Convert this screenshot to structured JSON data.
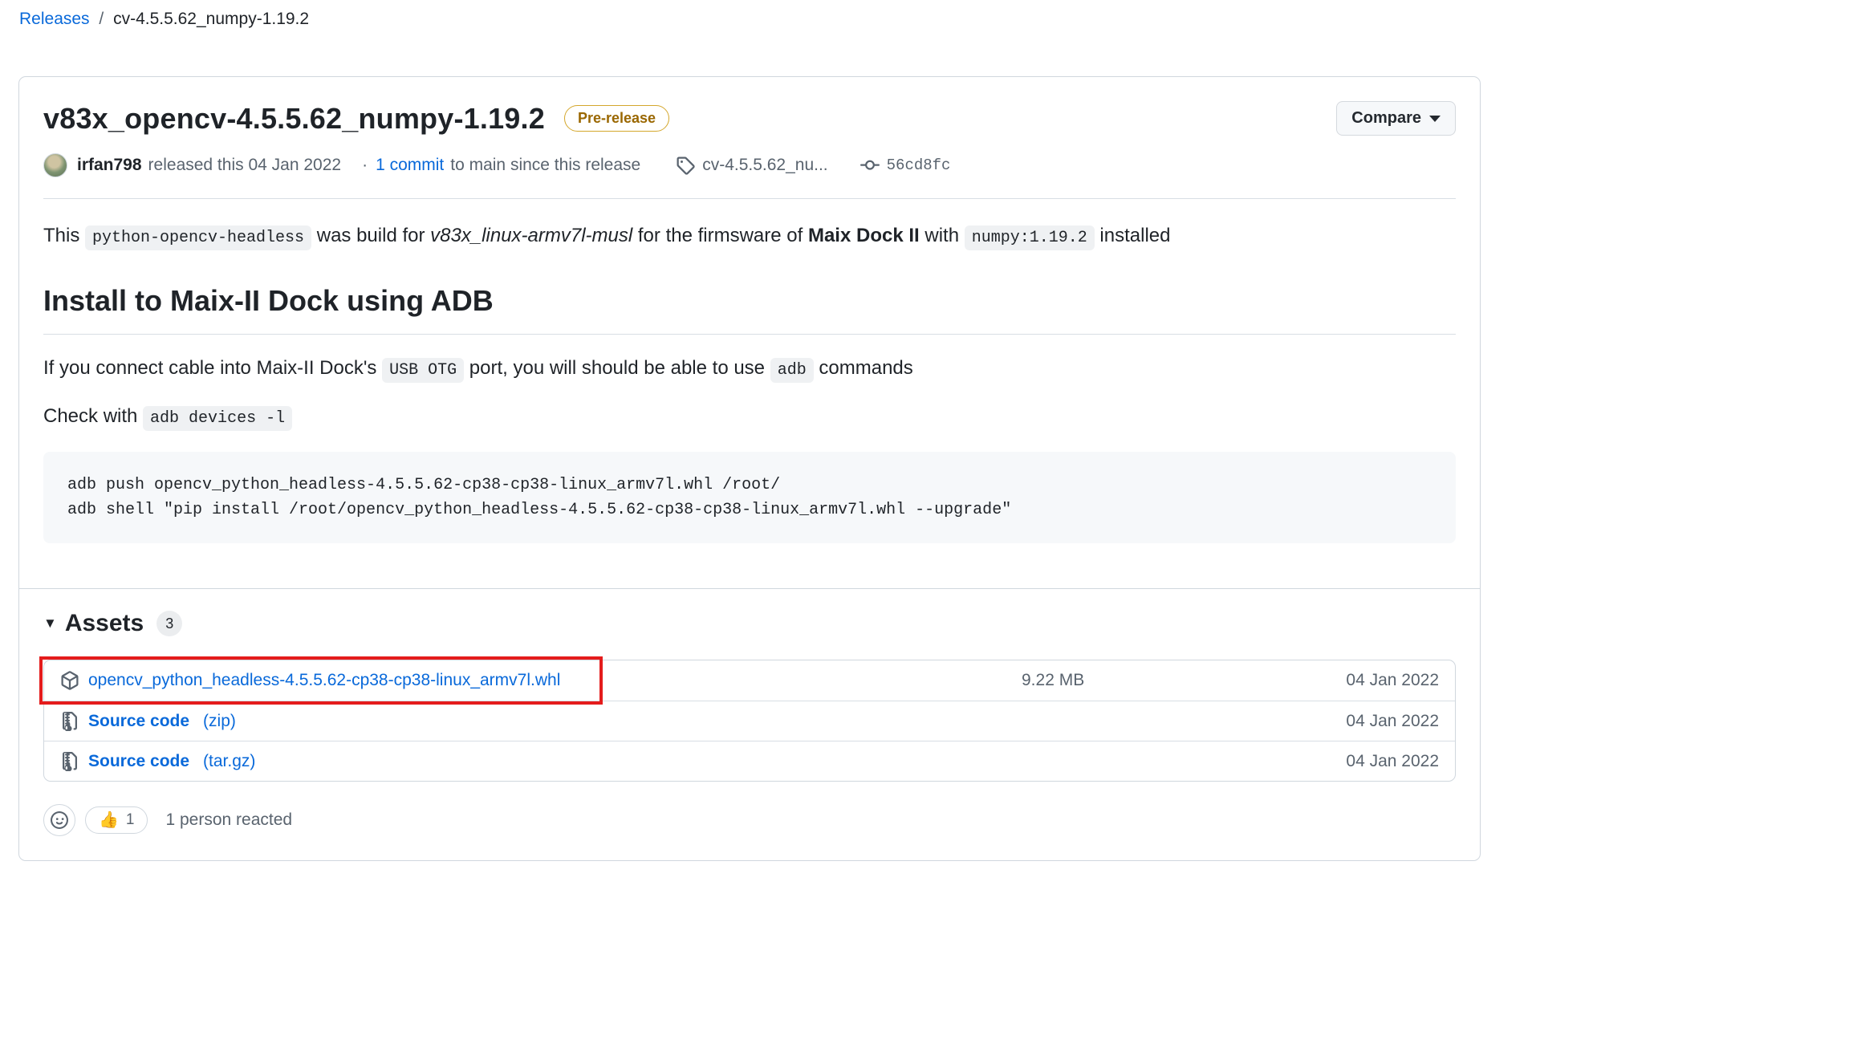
{
  "breadcrumb": {
    "releases": "Releases",
    "separator": "/",
    "current": "cv-4.5.5.62_numpy-1.19.2"
  },
  "header": {
    "title": "v83x_opencv-4.5.5.62_numpy-1.19.2",
    "prerelease_badge": "Pre-release",
    "compare_button": "Compare"
  },
  "meta": {
    "author": "irfan798",
    "released_text": "released this 04 Jan 2022",
    "dot": "·",
    "commit_link": "1 commit",
    "commit_suffix": "to main since this release",
    "tag_name": "cv-4.5.5.62_nu...",
    "commit_sha": "56cd8fc"
  },
  "body": {
    "intro": {
      "pre": "This",
      "code1": "python-opencv-headless",
      "mid1": "was build for",
      "italic": "v83x_linux-armv7l-musl",
      "mid2": "for the firmsware of",
      "bold": "Maix Dock II",
      "mid3": "with",
      "code2": "numpy:1.19.2",
      "post": "installed"
    },
    "h2": "Install to Maix-II Dock using ADB",
    "p1": {
      "pre": "If you connect cable into Maix-II Dock's",
      "code1": "USB OTG",
      "mid": "port, you will should be able to use",
      "code2": "adb",
      "post": "commands"
    },
    "p2": {
      "pre": "Check with",
      "code1": "adb devices -l"
    },
    "code_block": [
      "adb push opencv_python_headless-4.5.5.62-cp38-cp38-linux_armv7l.whl /root/",
      "adb shell \"pip install /root/opencv_python_headless-4.5.5.62-cp38-cp38-linux_armv7l.whl --upgrade\""
    ]
  },
  "assets": {
    "toggle_icon": "▼",
    "title": "Assets",
    "count": "3",
    "rows": [
      {
        "name": "opencv_python_headless-4.5.5.62-cp38-cp38-linux_armv7l.whl",
        "size": "9.22 MB",
        "date": "04 Jan 2022"
      },
      {
        "name": "Source code",
        "suffix": "(zip)",
        "date": "04 Jan 2022"
      },
      {
        "name": "Source code",
        "suffix": "(tar.gz)",
        "date": "04 Jan 2022"
      }
    ]
  },
  "reactions": {
    "thumbs_up_emoji": "👍",
    "thumbs_up_count": "1",
    "summary": "1 person reacted"
  },
  "colors": {
    "link_blue": "#0969da",
    "prerelease_gold": "#9a6700",
    "highlight_red": "#e41c1c"
  }
}
